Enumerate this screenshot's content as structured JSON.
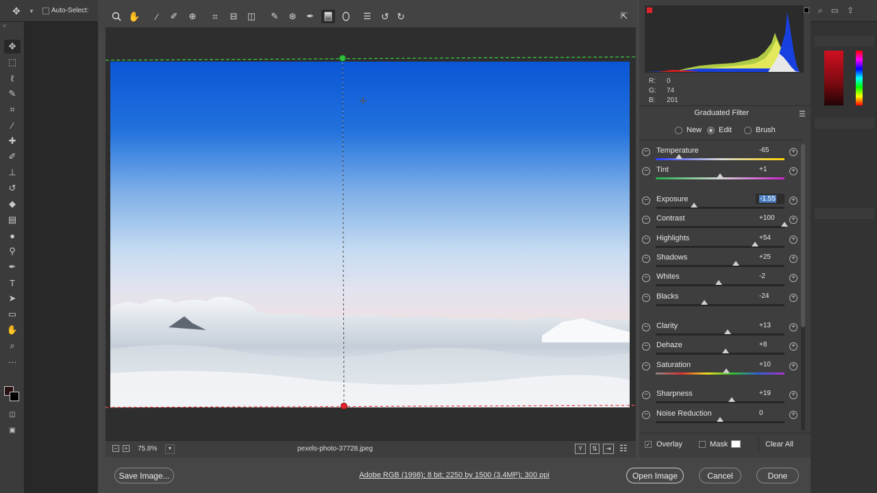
{
  "ps_options": {
    "auto_select_label": "Auto-Select:"
  },
  "dialog": {
    "tools": [
      "zoom-tool-icon",
      "hand-tool-icon",
      "white-balance-tool-icon",
      "color-sampler-tool-icon",
      "targeted-adjustment-tool-icon",
      "crop-tool-icon",
      "straighten-tool-icon",
      "transform-tool-icon",
      "spot-removal-tool-icon",
      "red-eye-removal-icon",
      "adjustment-brush-icon",
      "graduated-filter-icon",
      "radial-filter-icon",
      "preferences-icon",
      "rotate-left-icon",
      "rotate-right-icon"
    ],
    "active_tool": "graduated-filter-icon",
    "status": {
      "zoom": "75.8%",
      "filename": "pexels-photo-37728.jpeg"
    },
    "histogram": {
      "r_label": "R:",
      "g_label": "G:",
      "b_label": "B:",
      "r": "0",
      "g": "74",
      "b": "201"
    },
    "panel_title": "Graduated Filter",
    "mode": {
      "new": "New",
      "edit": "Edit",
      "brush": "Brush",
      "selected": "edit"
    },
    "sliders": [
      {
        "label": "Temperature",
        "value": "-65",
        "fraction": 0.18
      },
      {
        "label": "Tint",
        "value": "+1",
        "fraction": 0.5
      },
      {
        "label": "Exposure",
        "value": "-1.55",
        "fraction": 0.3,
        "selected": true
      },
      {
        "label": "Contrast",
        "value": "+100",
        "fraction": 1.0
      },
      {
        "label": "Highlights",
        "value": "+54",
        "fraction": 0.77
      },
      {
        "label": "Shadows",
        "value": "+25",
        "fraction": 0.62
      },
      {
        "label": "Whites",
        "value": "-2",
        "fraction": 0.49
      },
      {
        "label": "Blacks",
        "value": "-24",
        "fraction": 0.38
      },
      {
        "label": "Clarity",
        "value": "+13",
        "fraction": 0.56
      },
      {
        "label": "Dehaze",
        "value": "+8",
        "fraction": 0.54
      },
      {
        "label": "Saturation",
        "value": "+10",
        "fraction": 0.55
      },
      {
        "label": "Sharpness",
        "value": "+19",
        "fraction": 0.59
      },
      {
        "label": "Noise Reduction",
        "value": "0",
        "fraction": 0.5
      }
    ],
    "footer": {
      "overlay": "Overlay",
      "overlay_checked": true,
      "mask": "Mask",
      "mask_checked": false,
      "clear_all": "Clear All"
    },
    "bottom": {
      "save": "Save Image...",
      "workflow": "Adobe RGB (1998); 8 bit; 2250 by 1500 (3.4MP); 300 ppi",
      "open": "Open Image",
      "cancel": "Cancel",
      "done": "Done"
    }
  },
  "colors": {
    "green_pin": "#2fbf3a",
    "red_pin": "#e0242c",
    "accent": "#4d7ec2"
  }
}
